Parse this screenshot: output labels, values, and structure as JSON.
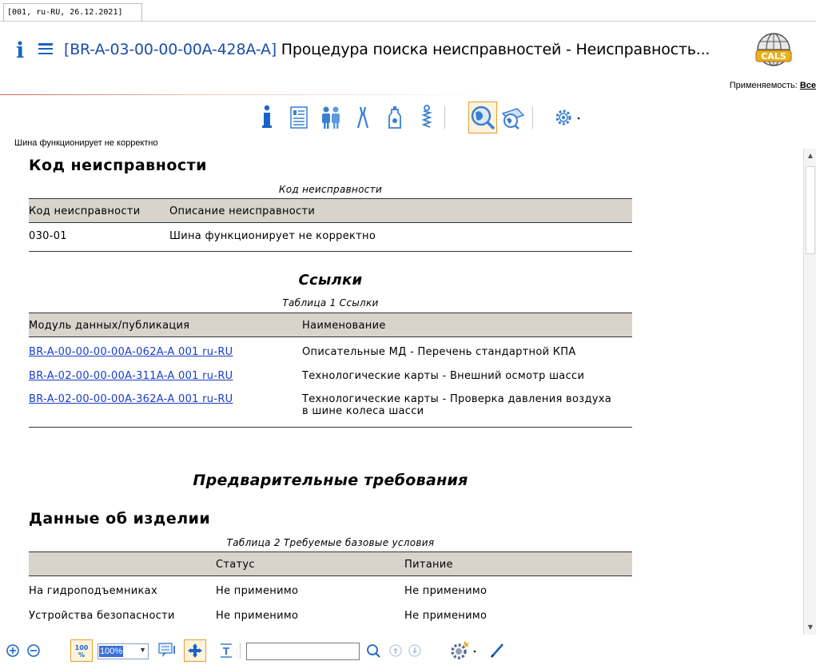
{
  "header": {
    "tag": "[001, ru-RU, 26.12.2021]",
    "info_glyph": "i",
    "code": "[BR-A-03-00-00-00A-428A-A]",
    "title": " Процедура поиска неисправностей - Неисправность...",
    "applicability_label": "Применяемость: ",
    "applicability_value": "Все"
  },
  "toolbar": {
    "icons": [
      "info-icon",
      "document-list-icon",
      "personnel-icon",
      "tools-icon",
      "consumables-icon",
      "spares-icon",
      "search-globe-icon",
      "print-settings-icon",
      "gear-icon"
    ],
    "active": "search-globe-icon"
  },
  "document": {
    "title": "Шина функционирует не корректно"
  },
  "fault_section": {
    "heading": "Код неисправности",
    "caption": "Код неисправности",
    "columns": [
      "Код неисправности",
      "Описание неисправности"
    ],
    "rows": [
      [
        "030-01",
        "Шина функционирует не корректно"
      ]
    ]
  },
  "refs_section": {
    "heading": "Ссылки",
    "caption": "Таблица 1   Ссылки",
    "columns": [
      "Модуль данных/публикация",
      "Наименование"
    ],
    "rows": [
      [
        "BR-A-00-00-00-00A-062A-A 001 ru-RU",
        "Описательные МД - Перечень стандартной КПА"
      ],
      [
        "BR-A-02-00-00-00A-311A-A 001 ru-RU",
        "Технологические карты - Внешний осмотр шасси"
      ],
      [
        "BR-A-02-00-00-00A-362A-A 001 ru-RU",
        "Технологические карты - Проверка давления воздуха",
        "в шине колеса шасси"
      ]
    ]
  },
  "prelim": {
    "heading": "Предварительные требования",
    "product_heading": "Данные об изделии",
    "caption": "Таблица 2   Требуемые базовые условия",
    "columns": [
      "",
      "Статус",
      "Питание"
    ],
    "rows": [
      [
        "На гидроподъемниках",
        "Не применимо",
        "Не применимо"
      ],
      [
        "Устройства безопасности",
        "Не применимо",
        "Не применимо"
      ]
    ]
  },
  "bottom": {
    "zoom": "100%",
    "zoom_icon_text": "100\n%",
    "search_value": ""
  },
  "colors": {
    "accent": "#1a63c8",
    "link": "#1a3cc8",
    "table_header": "#d8d4cc",
    "active_border": "#e0a030"
  }
}
